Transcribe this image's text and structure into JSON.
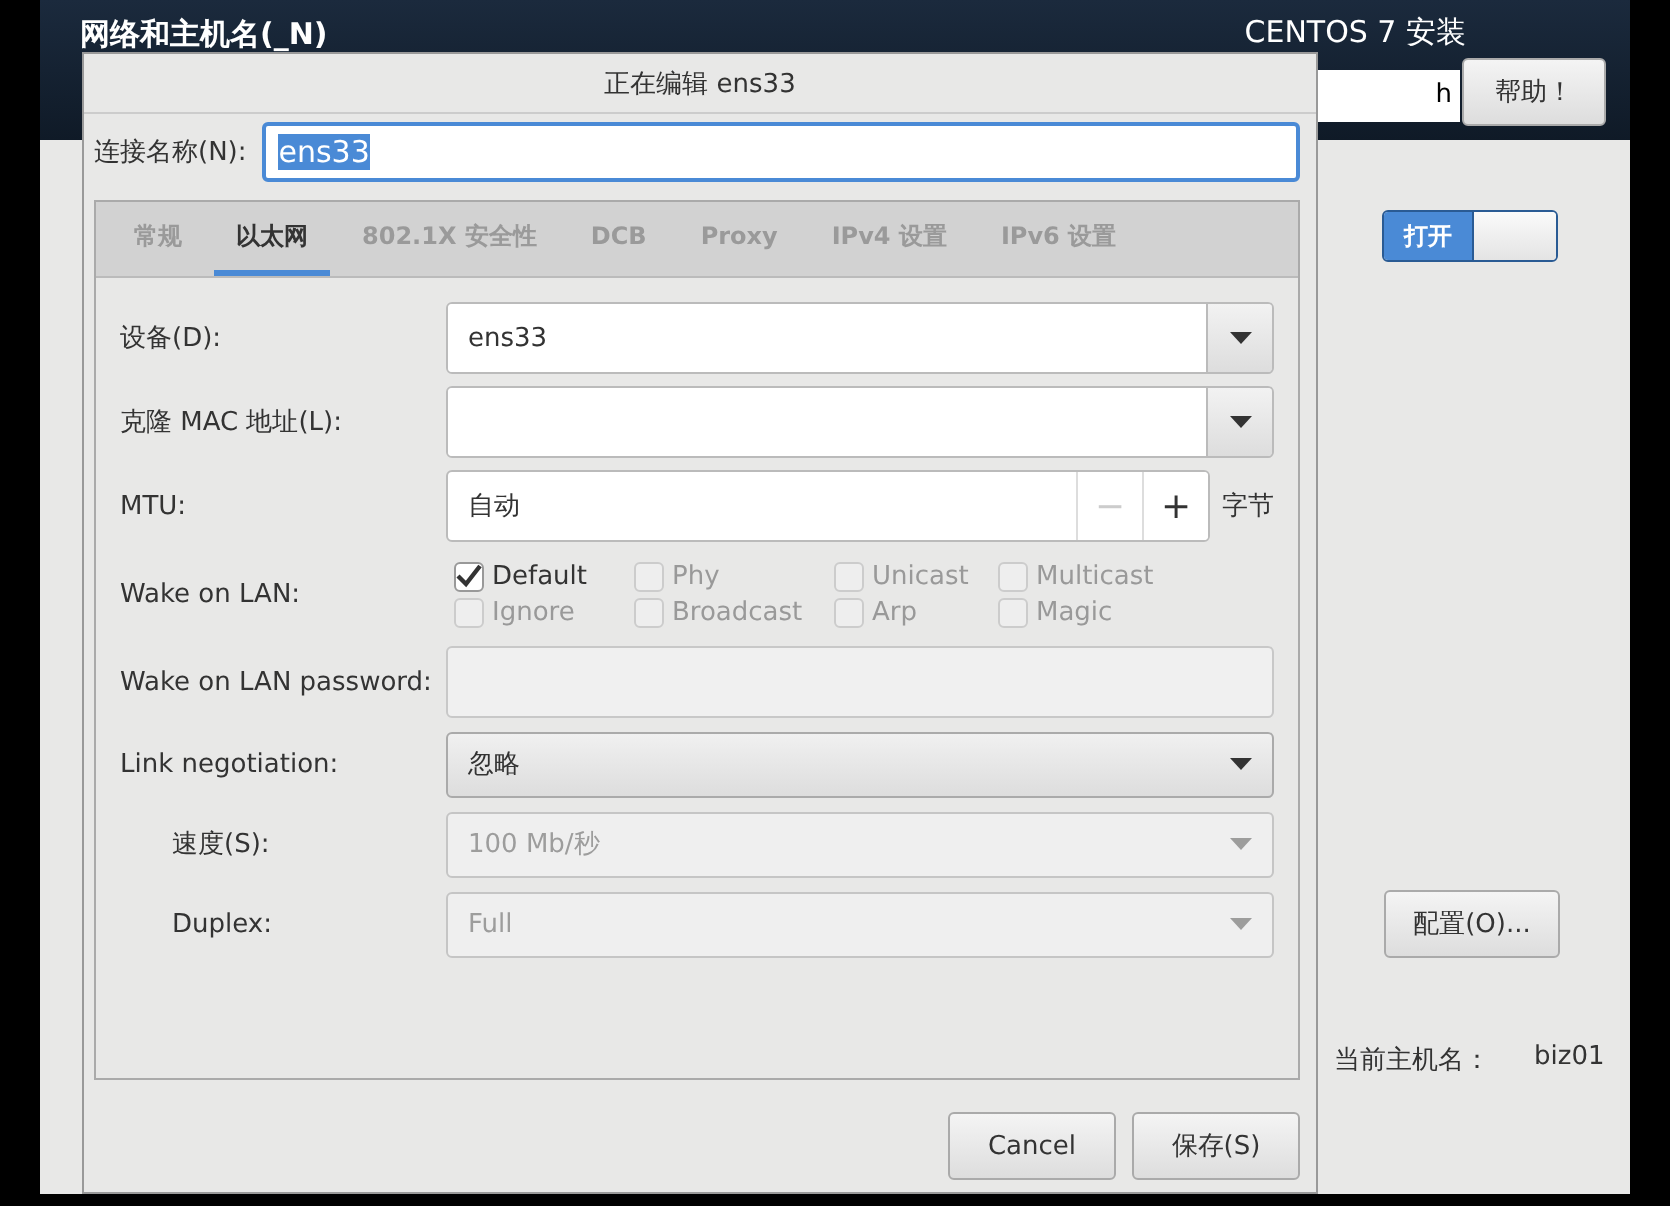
{
  "header": {
    "title": "网络和主机名(_N)",
    "product": "CENTOS 7 安装",
    "hostname_field": {
      "value": "h"
    },
    "help_button": "帮助！"
  },
  "device_switch": {
    "label": "打开",
    "on": true
  },
  "configure_button": "配置(O)...",
  "current_hostname": {
    "label": "当前主机名：",
    "value": "biz01"
  },
  "dialog": {
    "title": "正在编辑 ens33",
    "connection_name": {
      "label": "连接名称(N):",
      "value": "ens33",
      "text_selected": true
    },
    "tabs": [
      {
        "label": "常规",
        "selected": false
      },
      {
        "label": "以太网",
        "selected": true
      },
      {
        "label": "802.1X 安全性",
        "selected": false
      },
      {
        "label": "DCB",
        "selected": false
      },
      {
        "label": "Proxy",
        "selected": false
      },
      {
        "label": "IPv4 设置",
        "selected": false
      },
      {
        "label": "IPv6 设置",
        "selected": false
      }
    ],
    "rows": [
      {
        "kind": "combo",
        "label": "设备(D):",
        "value": "ens33",
        "indented": false
      },
      {
        "kind": "combo",
        "label": "克隆 MAC 地址(L):",
        "indented": false
      },
      {
        "kind": "spin",
        "label": "MTU:",
        "value": "自动",
        "minus": "−",
        "plus": "+",
        "unit": "字节",
        "indented": false,
        "minus_disabled": true
      },
      {
        "kind": "checks",
        "label": "Wake on LAN:",
        "indented": false,
        "options": [
          {
            "label": "Default",
            "checked": true,
            "disabled": false
          },
          {
            "label": "Phy",
            "checked": false,
            "disabled": true
          },
          {
            "label": "Unicast",
            "checked": false,
            "disabled": true
          },
          {
            "label": "Multicast",
            "checked": false,
            "disabled": true
          },
          {
            "label": "Ignore",
            "checked": false,
            "disabled": true
          },
          {
            "label": "Broadcast",
            "checked": false,
            "disabled": true
          },
          {
            "label": "Arp",
            "checked": false,
            "disabled": true
          },
          {
            "label": "Magic",
            "checked": false,
            "disabled": true
          }
        ]
      },
      {
        "kind": "entry",
        "label": "Wake on LAN password:",
        "indented": false,
        "disabled": true
      },
      {
        "kind": "dropdown",
        "label": "Link negotiation:",
        "value": "忽略",
        "indented": false,
        "disabled": false
      },
      {
        "kind": "dropdown",
        "label": "速度(S):",
        "value": "100 Mb/秒",
        "indented": true,
        "disabled": true
      },
      {
        "kind": "dropdown",
        "label": "Duplex:",
        "value": "Full",
        "indented": true,
        "disabled": true
      }
    ],
    "buttons": [
      {
        "label": "Cancel"
      },
      {
        "label": "保存(S)"
      }
    ]
  }
}
